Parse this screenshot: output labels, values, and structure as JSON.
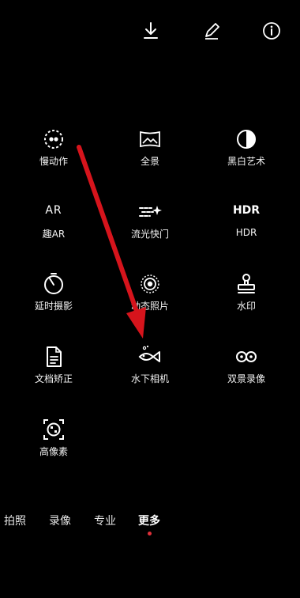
{
  "toolbar": {
    "icons": [
      "download-icon",
      "edit-icon",
      "info-icon"
    ]
  },
  "modes": [
    {
      "label": "慢动作",
      "icon": "slow-motion-icon"
    },
    {
      "label": "全景",
      "icon": "panorama-icon"
    },
    {
      "label": "黑白艺术",
      "icon": "monochrome-icon"
    },
    {
      "label": "趣AR",
      "icon": "ar-icon",
      "icon_text": "AR"
    },
    {
      "label": "流光快门",
      "icon": "light-painting-icon"
    },
    {
      "label": "HDR",
      "icon": "hdr-icon",
      "icon_text": "HDR"
    },
    {
      "label": "延时摄影",
      "icon": "timelapse-icon"
    },
    {
      "label": "动态照片",
      "icon": "moving-picture-icon"
    },
    {
      "label": "水印",
      "icon": "watermark-icon"
    },
    {
      "label": "文档矫正",
      "icon": "document-icon"
    },
    {
      "label": "水下相机",
      "icon": "underwater-fish-icon"
    },
    {
      "label": "双景录像",
      "icon": "dual-view-icon"
    },
    {
      "label": "高像素",
      "icon": "high-resolution-icon"
    }
  ],
  "tabs": [
    {
      "label": "拍照",
      "active": false
    },
    {
      "label": "录像",
      "active": false
    },
    {
      "label": "专业",
      "active": false
    },
    {
      "label": "更多",
      "active": true
    }
  ],
  "colors": {
    "background": "#000000",
    "annotation_arrow": "#d6141c",
    "active_indicator": "#e0303a"
  }
}
